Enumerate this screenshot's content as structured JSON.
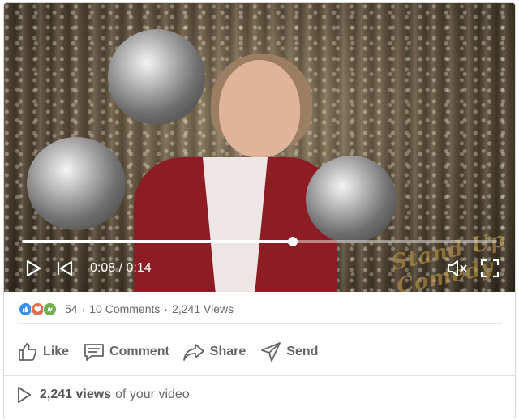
{
  "video": {
    "current_time": "0:08",
    "duration": "0:14",
    "progress_fraction": 0.57,
    "watermark_text": "Stand Up Comedy"
  },
  "stats": {
    "reaction_count": "54",
    "comments": "10 Comments",
    "views": "2,241 Views",
    "separator": "·",
    "reactions": [
      "like-reaction-icon",
      "love-reaction-icon",
      "celebrate-reaction-icon"
    ]
  },
  "actions": [
    {
      "label": "Like",
      "icon": "thumbs-up-icon"
    },
    {
      "label": "Comment",
      "icon": "comment-icon"
    },
    {
      "label": "Share",
      "icon": "share-arrow-icon"
    },
    {
      "label": "Send",
      "icon": "send-icon"
    }
  ],
  "footer": {
    "views_count": "2,241 views",
    "views_suffix": "of your video"
  }
}
